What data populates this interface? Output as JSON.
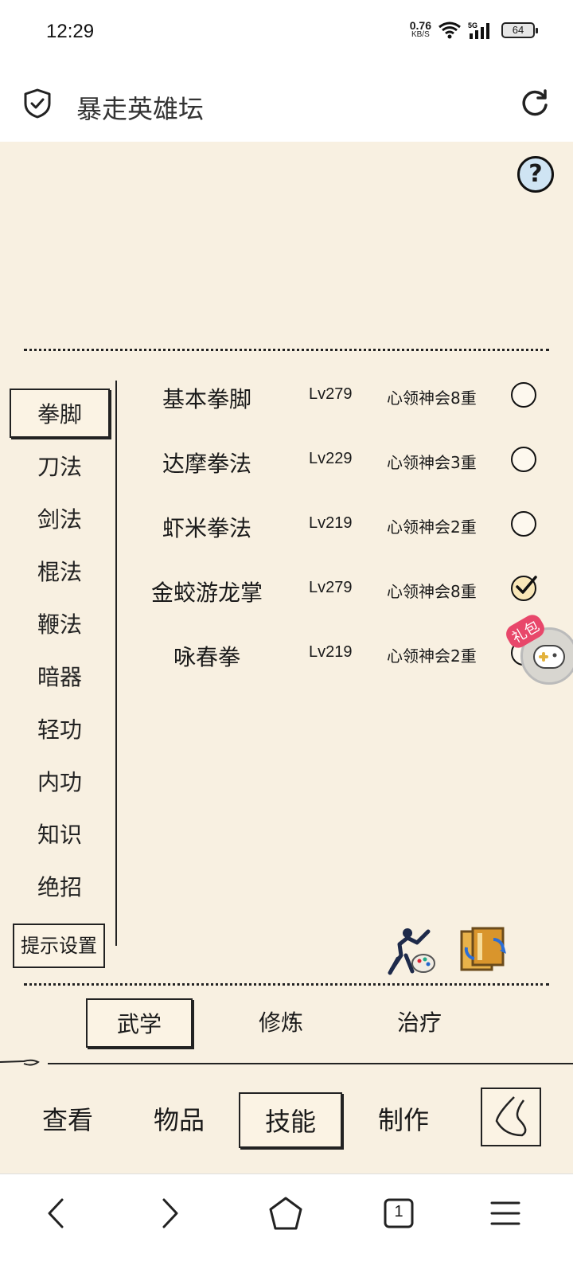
{
  "status": {
    "time": "12:29",
    "net_speed": "0.76",
    "net_unit": "KB/S",
    "battery": "64"
  },
  "header": {
    "title": "暴走英雄坛"
  },
  "game": {
    "help": "?",
    "categories": [
      "拳脚",
      "刀法",
      "剑法",
      "棍法",
      "鞭法",
      "暗器",
      "轻功",
      "内功",
      "知识",
      "绝招"
    ],
    "active_category": "拳脚",
    "tip_settings": "提示设置",
    "skills": [
      {
        "name": "基本拳脚",
        "level": "Lv279",
        "rank": "心领神会8重",
        "checked": false
      },
      {
        "name": "达摩拳法",
        "level": "Lv229",
        "rank": "心领神会3重",
        "checked": false
      },
      {
        "name": "虾米拳法",
        "level": "Lv219",
        "rank": "心领神会2重",
        "checked": false
      },
      {
        "name": "金蛟游龙掌",
        "level": "Lv279",
        "rank": "心领神会8重",
        "checked": true
      },
      {
        "name": "咏春拳",
        "level": "Lv219",
        "rank": "心领神会2重",
        "checked": false
      }
    ],
    "gift_label": "礼包",
    "subtabs": [
      "武学",
      "修炼",
      "治疗"
    ],
    "active_subtab": "武学"
  },
  "game_nav": {
    "items": [
      "查看",
      "物品",
      "技能",
      "制作"
    ],
    "active": "技能"
  },
  "browser_nav": {
    "tab_count": "1"
  }
}
